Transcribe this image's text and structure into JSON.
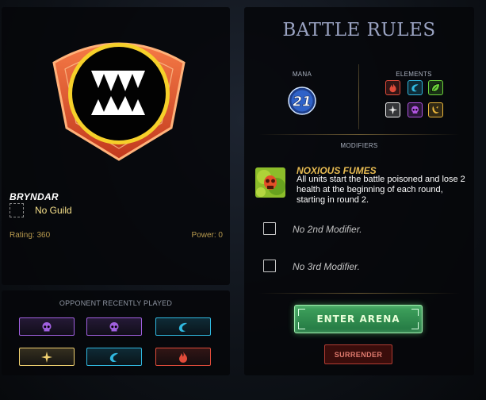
{
  "player": {
    "name": "BRYNDAR",
    "guild": "No Guild",
    "rating_label": "Rating: 360",
    "power_label": "Power: 0"
  },
  "opponent_recent": {
    "title": "OPPONENT RECENTLY PLAYED",
    "items": [
      {
        "element": "death",
        "icon": "skull-icon",
        "color": "#a060e0"
      },
      {
        "element": "death",
        "icon": "skull-icon",
        "color": "#a060e0"
      },
      {
        "element": "water",
        "icon": "water-wave-icon",
        "color": "#30b8e0"
      },
      {
        "element": "life",
        "icon": "sparkle-icon",
        "color": "#f0d070"
      },
      {
        "element": "water",
        "icon": "water-wave-icon",
        "color": "#30b8e0"
      },
      {
        "element": "fire",
        "icon": "flame-icon",
        "color": "#e04b3a"
      }
    ]
  },
  "battle": {
    "title": "BATTLE RULES",
    "mana_label": "MANA",
    "mana_value": "21",
    "elements_label": "ELEMENTS",
    "elements": [
      {
        "name": "fire",
        "icon": "flame-icon",
        "color": "#e04b3a"
      },
      {
        "name": "water",
        "icon": "water-wave-icon",
        "color": "#30b8e0"
      },
      {
        "name": "earth",
        "icon": "leaf-icon",
        "color": "#6bd13a"
      },
      {
        "name": "life",
        "icon": "sparkle-icon",
        "color": "#f2f2f2"
      },
      {
        "name": "death",
        "icon": "skull-icon",
        "color": "#b054e0"
      },
      {
        "name": "dragon",
        "icon": "dragon-icon",
        "color": "#e8b43a"
      }
    ],
    "modifiers_label": "MODIFIERS",
    "modifier": {
      "name": "NOXIOUS FUMES",
      "description": "All units start the battle poisoned and lose 2 health at the beginning of each round, starting in round 2."
    },
    "empty_modifier_2": "No 2nd Modifier.",
    "empty_modifier_3": "No 3rd Modifier.",
    "enter_label": "Enter Arena",
    "surrender_label": "SURRENDER"
  },
  "colors": {
    "accent_gold": "#e8bc52",
    "enter_green": "#3fa35d",
    "surrender_red": "#b23c33"
  }
}
